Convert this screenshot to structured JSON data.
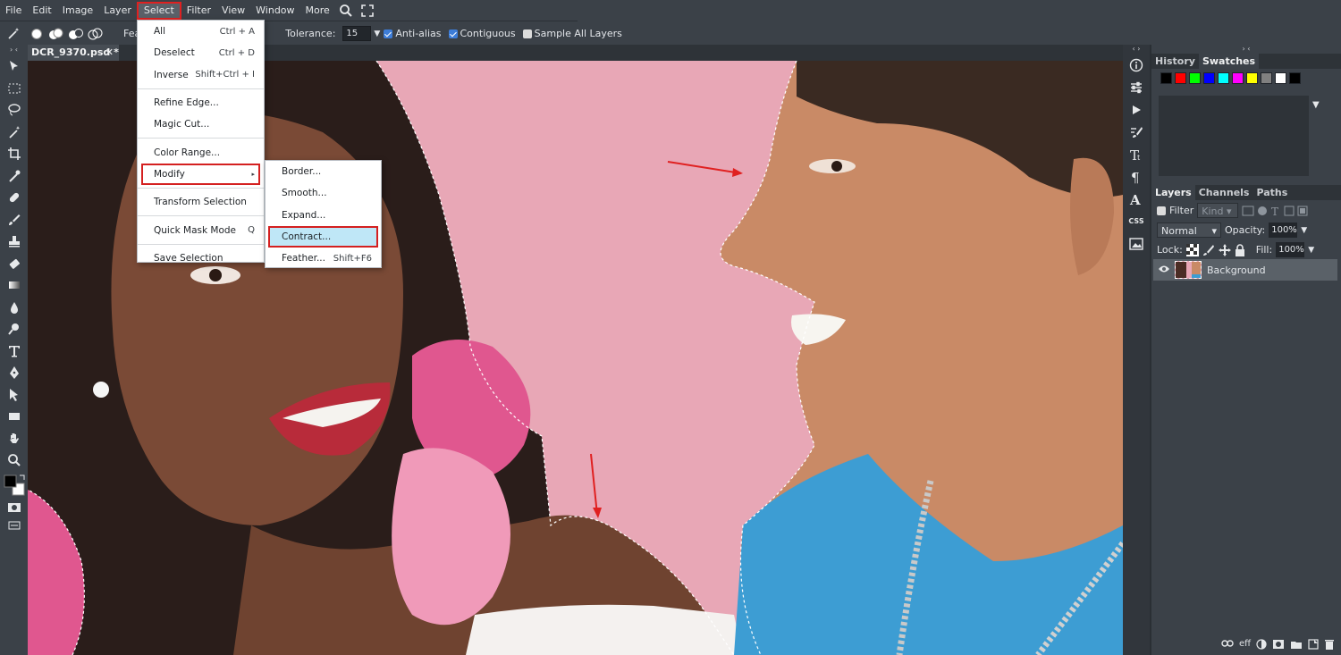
{
  "menubar": {
    "items": [
      "File",
      "Edit",
      "Image",
      "Layer",
      "Select",
      "Filter",
      "View",
      "Window",
      "More"
    ],
    "active": "Select"
  },
  "options": {
    "feather_label": "Fea",
    "tolerance_label": "Tolerance:",
    "tolerance_value": "15",
    "anti_alias": "Anti-alias",
    "contiguous": "Contiguous",
    "sample_all_layers": "Sample All Layers"
  },
  "document": {
    "tab_title": "DCR_9370.psd *",
    "close": "✕"
  },
  "select_menu": {
    "items": [
      {
        "label": "All",
        "shortcut": "Ctrl + A"
      },
      {
        "label": "Deselect",
        "shortcut": "Ctrl + D"
      },
      {
        "label": "Inverse",
        "shortcut": "Shift+Ctrl + I"
      },
      {
        "label": "Refine Edge...",
        "shortcut": ""
      },
      {
        "label": "Magic Cut...",
        "shortcut": ""
      },
      {
        "label": "Color Range...",
        "shortcut": ""
      },
      {
        "label": "Modify",
        "shortcut": "▸"
      },
      {
        "label": "Transform Selection",
        "shortcut": ""
      },
      {
        "label": "Quick Mask Mode",
        "shortcut": "Q"
      },
      {
        "label": "Save Selection",
        "shortcut": ""
      }
    ]
  },
  "modify_menu": {
    "items": [
      {
        "label": "Border...",
        "shortcut": ""
      },
      {
        "label": "Smooth...",
        "shortcut": ""
      },
      {
        "label": "Expand...",
        "shortcut": ""
      },
      {
        "label": "Contract...",
        "shortcut": ""
      },
      {
        "label": "Feather...",
        "shortcut": "Shift+F6"
      }
    ]
  },
  "history_panel": {
    "tabs": [
      "History",
      "Swatches"
    ],
    "swatch_colors": [
      "#000000",
      "#ff0000",
      "#00ff00",
      "#0000ff",
      "#00ffff",
      "#ff00ff",
      "#ffff00",
      "#808080",
      "#ffffff",
      "#000000"
    ]
  },
  "layers_panel": {
    "tabs": [
      "Layers",
      "Channels",
      "Paths"
    ],
    "filter_label": "Filter",
    "kind_label": "Kind",
    "blend_mode": "Normal",
    "opacity_label": "Opacity:",
    "opacity_value": "100%",
    "lock_label": "Lock:",
    "fill_label": "Fill:",
    "fill_value": "100%",
    "layer_name": "Background",
    "footer_eff": "eff"
  },
  "right_strip": {
    "css_label": "CSS"
  },
  "colors": {
    "canvas_bg": "#e9a8b7",
    "accent_red": "#d42020",
    "ui_bg": "#3b4148"
  }
}
